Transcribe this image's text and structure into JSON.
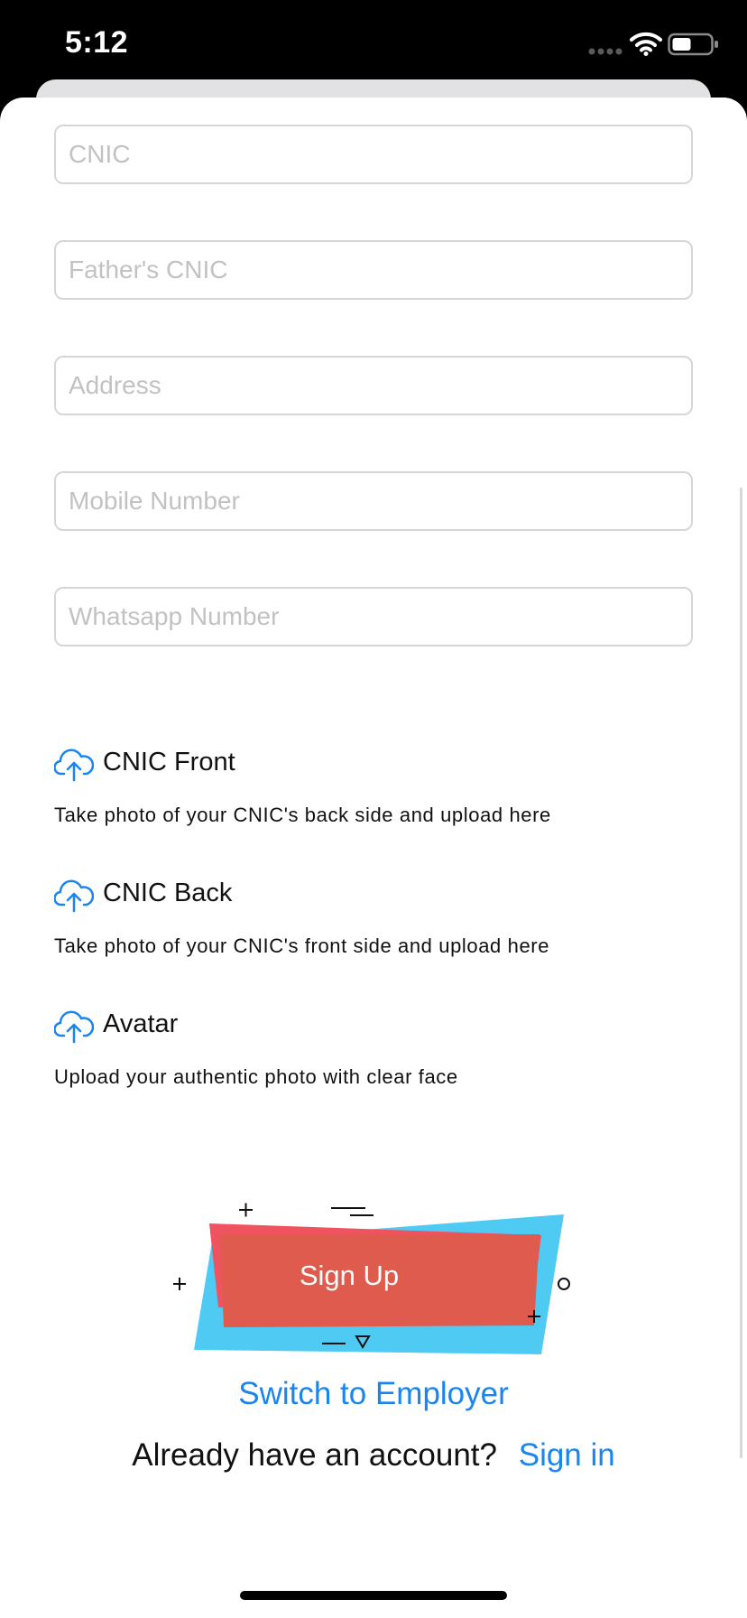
{
  "status_bar": {
    "time": "5:12",
    "icons": [
      "cellular-signal-icon",
      "wifi-icon",
      "battery-icon"
    ]
  },
  "form": {
    "fields": [
      {
        "name": "cnic",
        "placeholder": "CNIC",
        "value": ""
      },
      {
        "name": "fathers-cnic",
        "placeholder": "Father's CNIC",
        "value": ""
      },
      {
        "name": "address",
        "placeholder": "Address",
        "value": ""
      },
      {
        "name": "mobile-number",
        "placeholder": "Mobile Number",
        "value": ""
      },
      {
        "name": "whatsapp-number",
        "placeholder": "Whatsapp Number",
        "value": ""
      }
    ]
  },
  "uploads": [
    {
      "title": "CNIC Front",
      "description": "Take photo of your CNIC's back side and upload here",
      "icon": "cloud-upload-icon"
    },
    {
      "title": "CNIC Back",
      "description": "Take photo of your CNIC's front side and upload here",
      "icon": "cloud-upload-icon"
    },
    {
      "title": "Avatar",
      "description": "Upload your authentic photo with clear face",
      "icon": "cloud-upload-icon"
    }
  ],
  "actions": {
    "signup_label": "Sign Up",
    "switch_label": "Switch to Employer",
    "account_prompt": "Already have an account?",
    "signin_label": "Sign in"
  },
  "colors": {
    "accent_blue": "#1a85ee",
    "signup_red": "#de5b4e",
    "signup_pink": "#f05360",
    "signup_cyan": "#4fcaf3",
    "placeholder": "#c2c2c4",
    "field_border": "#d6d6d6"
  }
}
